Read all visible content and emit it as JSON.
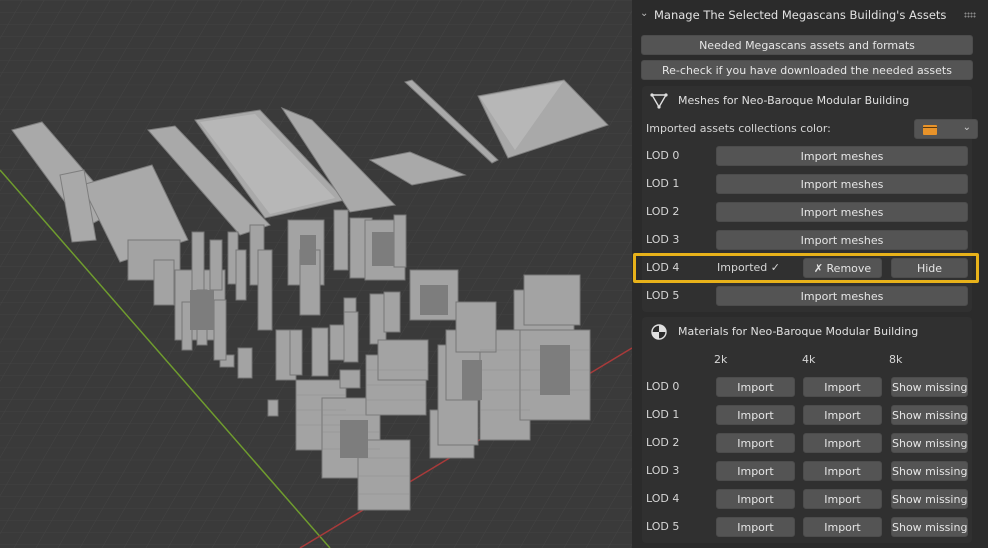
{
  "panel": {
    "header": "Manage The Selected Megascans Building's Assets",
    "needed_btn": "Needed Megascans assets and formats",
    "recheck_btn": "Re-check if you have downloaded the needed assets",
    "meshes": {
      "title": "Meshes for Neo-Baroque Modular Building",
      "collections_color_label": "Imported assets collections color:",
      "collections_color": "#e8932a",
      "rows": [
        {
          "lod": "LOD 0",
          "button": "Import meshes"
        },
        {
          "lod": "LOD 1",
          "button": "Import meshes"
        },
        {
          "lod": "LOD 2",
          "button": "Import meshes"
        },
        {
          "lod": "LOD 3",
          "button": "Import meshes"
        },
        {
          "lod": "LOD 4",
          "status": "Imported ✓",
          "remove": "✗ Remove",
          "hide": "Hide"
        },
        {
          "lod": "LOD 5",
          "button": "Import meshes"
        }
      ]
    },
    "materials": {
      "title": "Materials for Neo-Baroque Modular Building",
      "columns": [
        "2k",
        "4k",
        "8k"
      ],
      "rows": [
        {
          "lod": "LOD 0",
          "c2k": "Import",
          "c4k": "Import",
          "c8k": "Show missing"
        },
        {
          "lod": "LOD 1",
          "c2k": "Import",
          "c4k": "Import",
          "c8k": "Show missing"
        },
        {
          "lod": "LOD 2",
          "c2k": "Import",
          "c4k": "Import",
          "c8k": "Show missing"
        },
        {
          "lod": "LOD 3",
          "c2k": "Import",
          "c4k": "Import",
          "c8k": "Show missing"
        },
        {
          "lod": "LOD 4",
          "c2k": "Import",
          "c4k": "Import",
          "c8k": "Show missing"
        },
        {
          "lod": "LOD 5",
          "c2k": "Import",
          "c4k": "Import",
          "c8k": "Show missing"
        }
      ]
    }
  },
  "highlight_color": "#e8b21a"
}
